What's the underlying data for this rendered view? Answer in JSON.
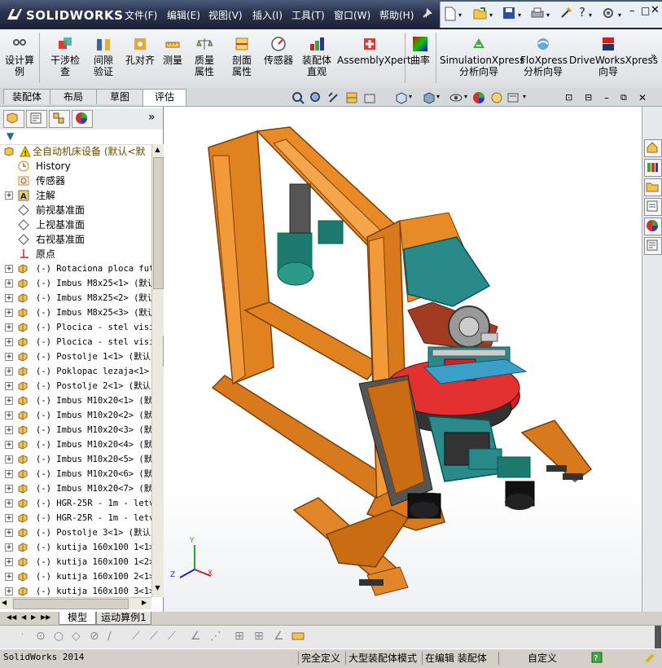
{
  "app": {
    "name": "SOLIDWORKS",
    "status_version": "SolidWorks 2014"
  },
  "menu": [
    "文件(F)",
    "编辑(E)",
    "视图(V)",
    "插入(I)",
    "工具(T)",
    "窗口(W)",
    "帮助(H)"
  ],
  "ribbon": {
    "buttons": [
      {
        "label": "设计算例",
        "icon": "design-study-icon"
      },
      {
        "label": "干涉检查",
        "icon": "interference-check-icon"
      },
      {
        "label": "间隙验证",
        "icon": "clearance-verify-icon"
      },
      {
        "label": "孔对齐",
        "icon": "hole-alignment-icon"
      },
      {
        "label": "测量",
        "icon": "measure-icon"
      },
      {
        "label": "质量属性",
        "icon": "mass-properties-icon"
      },
      {
        "label": "剖面属性",
        "icon": "section-properties-icon"
      },
      {
        "label": "传感器",
        "icon": "sensor-icon"
      },
      {
        "label": "装配体直观",
        "icon": "assembly-visualization-icon"
      },
      {
        "label": "AssemblyXpert",
        "icon": "assemblyxpert-icon"
      },
      {
        "label": "曲率",
        "icon": "curvature-icon"
      },
      {
        "label": "SimulationXpress 分析向导",
        "icon": "simulationxpress-icon"
      },
      {
        "label": "FloXpress 分析向导",
        "icon": "floxpress-icon"
      },
      {
        "label": "DriveWorksXpress 向导",
        "icon": "driveworksxpress-icon"
      }
    ],
    "overflow": "»"
  },
  "tabs": [
    "装配体",
    "布局",
    "草图",
    "评估"
  ],
  "active_tab": "评估",
  "tree": {
    "root": "全自动机床设备  (默认<默",
    "items": [
      {
        "label": "History",
        "icon": "history-icon",
        "expand": false
      },
      {
        "label": "传感器",
        "icon": "sensor-folder-icon",
        "expand": false
      },
      {
        "label": "注解",
        "icon": "annotation-icon",
        "expand": true
      },
      {
        "label": "前视基准面",
        "icon": "plane-icon",
        "expand": false
      },
      {
        "label": "上视基准面",
        "icon": "plane-icon",
        "expand": false
      },
      {
        "label": "右视基准面",
        "icon": "plane-icon",
        "expand": false
      },
      {
        "label": "原点",
        "icon": "origin-icon",
        "expand": false
      },
      {
        "label": "(-) Rotaciona ploca futo",
        "icon": "part-icon",
        "expand": true
      },
      {
        "label": "(-) Imbus M8x25<1> (默认",
        "icon": "part-icon",
        "expand": true
      },
      {
        "label": "(-) Imbus M8x25<2> (默认",
        "icon": "part-icon",
        "expand": true
      },
      {
        "label": "(-) Imbus M8x25<3> (默认",
        "icon": "part-icon",
        "expand": true
      },
      {
        "label": "(-) Plocica - stel visi",
        "icon": "part-icon",
        "expand": true
      },
      {
        "label": "(-) Plocica - stel visi",
        "icon": "part-icon",
        "expand": true
      },
      {
        "label": "(-) Postolje 1<1> (默认",
        "icon": "part-icon",
        "expand": true
      },
      {
        "label": "(-) Poklopac lezaja<1>",
        "icon": "part-icon",
        "expand": true
      },
      {
        "label": "(-) Postolje 2<1> (默认",
        "icon": "part-icon",
        "expand": true
      },
      {
        "label": "(-) Imbus M10x20<1> (默",
        "icon": "part-icon",
        "expand": true
      },
      {
        "label": "(-) Imbus M10x20<2> (默",
        "icon": "part-icon",
        "expand": true
      },
      {
        "label": "(-) Imbus M10x20<3> (默",
        "icon": "part-icon",
        "expand": true
      },
      {
        "label": "(-) Imbus M10x20<4> (默",
        "icon": "part-icon",
        "expand": true
      },
      {
        "label": "(-) Imbus M10x20<5> (默",
        "icon": "part-icon",
        "expand": true
      },
      {
        "label": "(-) Imbus M10x20<6> (默",
        "icon": "part-icon",
        "expand": true
      },
      {
        "label": "(-) Imbus M10x20<7> (默",
        "icon": "part-icon",
        "expand": true
      },
      {
        "label": "(-) HGR-25R - 1m - letv",
        "icon": "part-icon",
        "expand": true
      },
      {
        "label": "(-) HGR-25R - 1m - letv",
        "icon": "part-icon",
        "expand": true
      },
      {
        "label": "(-) Postolje 3<1> (默认",
        "icon": "part-icon",
        "expand": true
      },
      {
        "label": "(-) kutija 160x100 1<1>",
        "icon": "part-icon",
        "expand": true
      },
      {
        "label": "(-) kutija 160x100 1<2>",
        "icon": "part-icon",
        "expand": true
      },
      {
        "label": "(-) kutija 160x100 2<1>",
        "icon": "part-icon",
        "expand": true
      },
      {
        "label": "(-) kutija 160x100 3<1>",
        "icon": "part-icon",
        "expand": true
      }
    ]
  },
  "bottom_tabs": [
    "模型",
    "运动算例1"
  ],
  "status": [
    "SolidWorks 2014",
    "完全定义",
    "大型装配体模式",
    "在编辑 装配体",
    "自定义"
  ],
  "axes": {
    "x": "X",
    "y": "Y",
    "z": "Z"
  },
  "colors": {
    "frame": "#d97a1e",
    "teal": "#2a8a8a",
    "red": "#d42020",
    "ribbon_bg": "#e6e8ec"
  }
}
